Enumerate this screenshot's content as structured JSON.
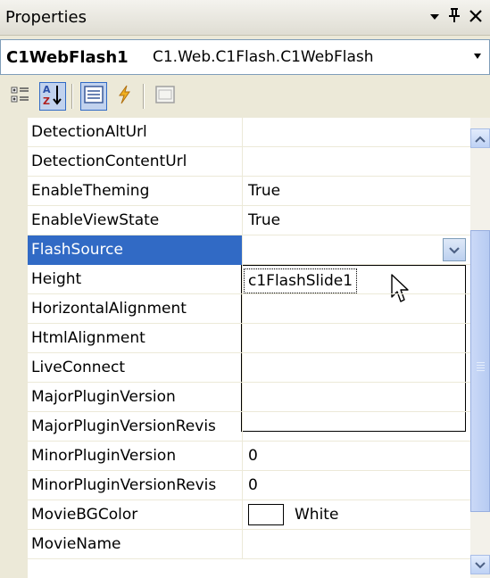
{
  "titlebar": {
    "title": "Properties",
    "dropdown_glyph": "▾",
    "pin_glyph": "ꟷ",
    "close_glyph": "✕"
  },
  "object_selector": {
    "name": "C1WebFlash1",
    "type": "C1.Web.C1Flash.C1WebFlash",
    "dropdown_glyph": "▼"
  },
  "toolbar": {
    "buttons": [
      {
        "name": "categorized-icon",
        "active": false
      },
      {
        "name": "alphabetical-icon",
        "active": true
      },
      {
        "name": "properties-icon",
        "active": true
      },
      {
        "name": "events-icon",
        "active": false
      },
      {
        "name": "property-pages-icon",
        "active": false
      }
    ]
  },
  "properties": [
    {
      "name": "DetectionAltUrl",
      "value": ""
    },
    {
      "name": "DetectionContentUrl",
      "value": ""
    },
    {
      "name": "EnableTheming",
      "value": "True"
    },
    {
      "name": "EnableViewState",
      "value": "True"
    },
    {
      "name": "FlashSource",
      "value": ""
    },
    {
      "name": "Height",
      "value": ""
    },
    {
      "name": "HorizontalAlignment",
      "value": ""
    },
    {
      "name": "HtmlAlignment",
      "value": ""
    },
    {
      "name": "LiveConnect",
      "value": ""
    },
    {
      "name": "MajorPluginVersion",
      "value": ""
    },
    {
      "name": "MajorPluginVersionRevis",
      "value": ""
    },
    {
      "name": "MinorPluginVersion",
      "value": "0"
    },
    {
      "name": "MinorPluginVersionRevis",
      "value": "0"
    },
    {
      "name": "MovieBGColor",
      "value": "White"
    },
    {
      "name": "MovieName",
      "value": ""
    }
  ],
  "selected_property": "FlashSource",
  "dropdown_list": {
    "items": [
      "c1FlashSlide1"
    ]
  },
  "colors": {
    "selection": "#316ac5",
    "gutter": "#ece9d8",
    "scroll_thumb": "#c1d2ee",
    "movie_bg_color": "#ffffff"
  }
}
